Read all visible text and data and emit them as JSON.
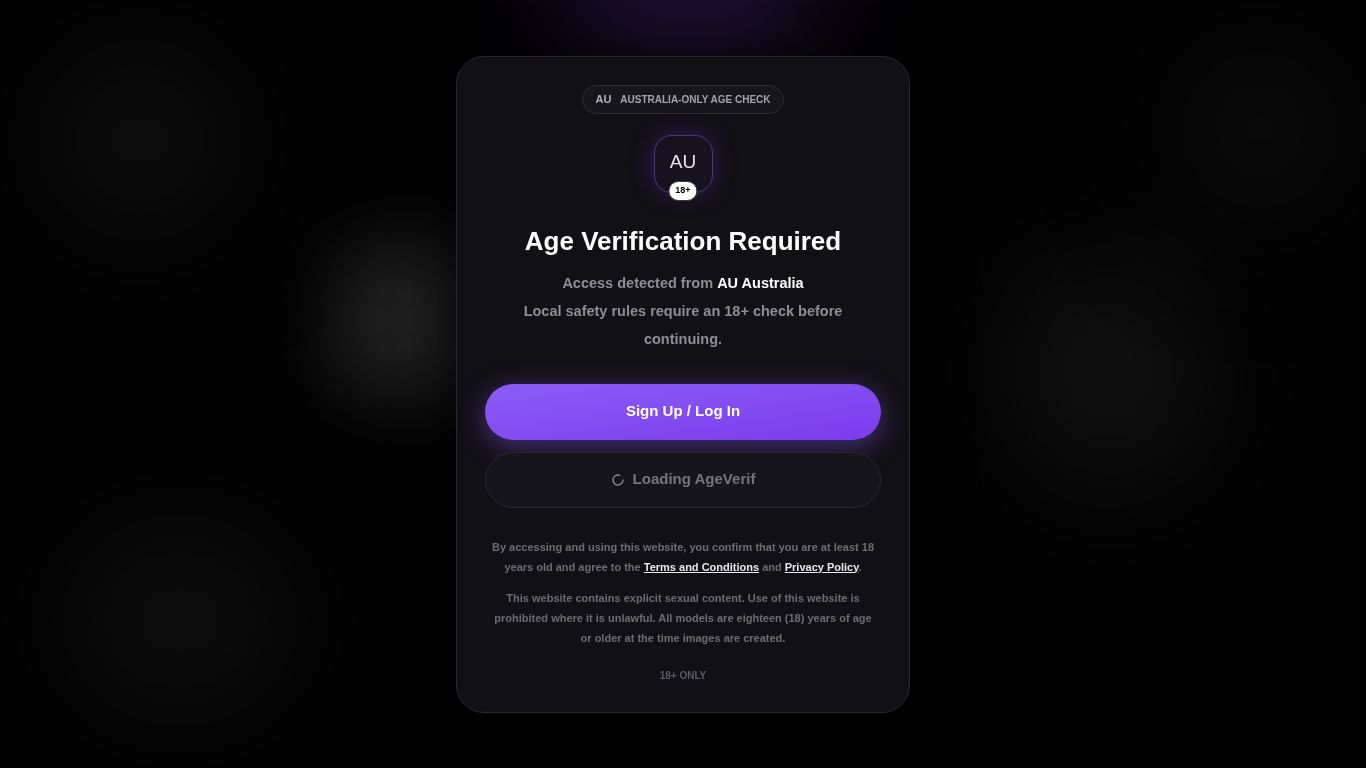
{
  "region_pill": {
    "flag": "AU",
    "label": "AUSTRALIA-ONLY AGE CHECK"
  },
  "emblem": {
    "code": "AU",
    "age_badge": "18+"
  },
  "title": "Age Verification Required",
  "location_line": "Access detected from **AU Australia**",
  "notice": "Local safety rules require an 18+ check before continuing.",
  "buttons": [
    {
      "kind": "primary",
      "label": "Sign Up / Log In",
      "disabled": false,
      "loading": false
    },
    {
      "kind": "secondary",
      "label": "Loading AgeVerif",
      "disabled": true,
      "loading": true
    }
  ],
  "terms": [
    {
      "kind": "text",
      "text": "By accessing and using this website, you confirm that you are at least 18 years old and agree to the "
    },
    {
      "kind": "link",
      "text": "Terms and Conditions"
    },
    {
      "kind": "text",
      "text": " and "
    },
    {
      "kind": "link",
      "text": "Privacy Policy"
    },
    {
      "kind": "text",
      "text": "."
    }
  ],
  "disclaimer": "This website contains explicit sexual content. Use of this website is prohibited where it is unlawful. All models are eighteen (18) years of age or older at the time images are created.",
  "footer": "18+ ONLY"
}
